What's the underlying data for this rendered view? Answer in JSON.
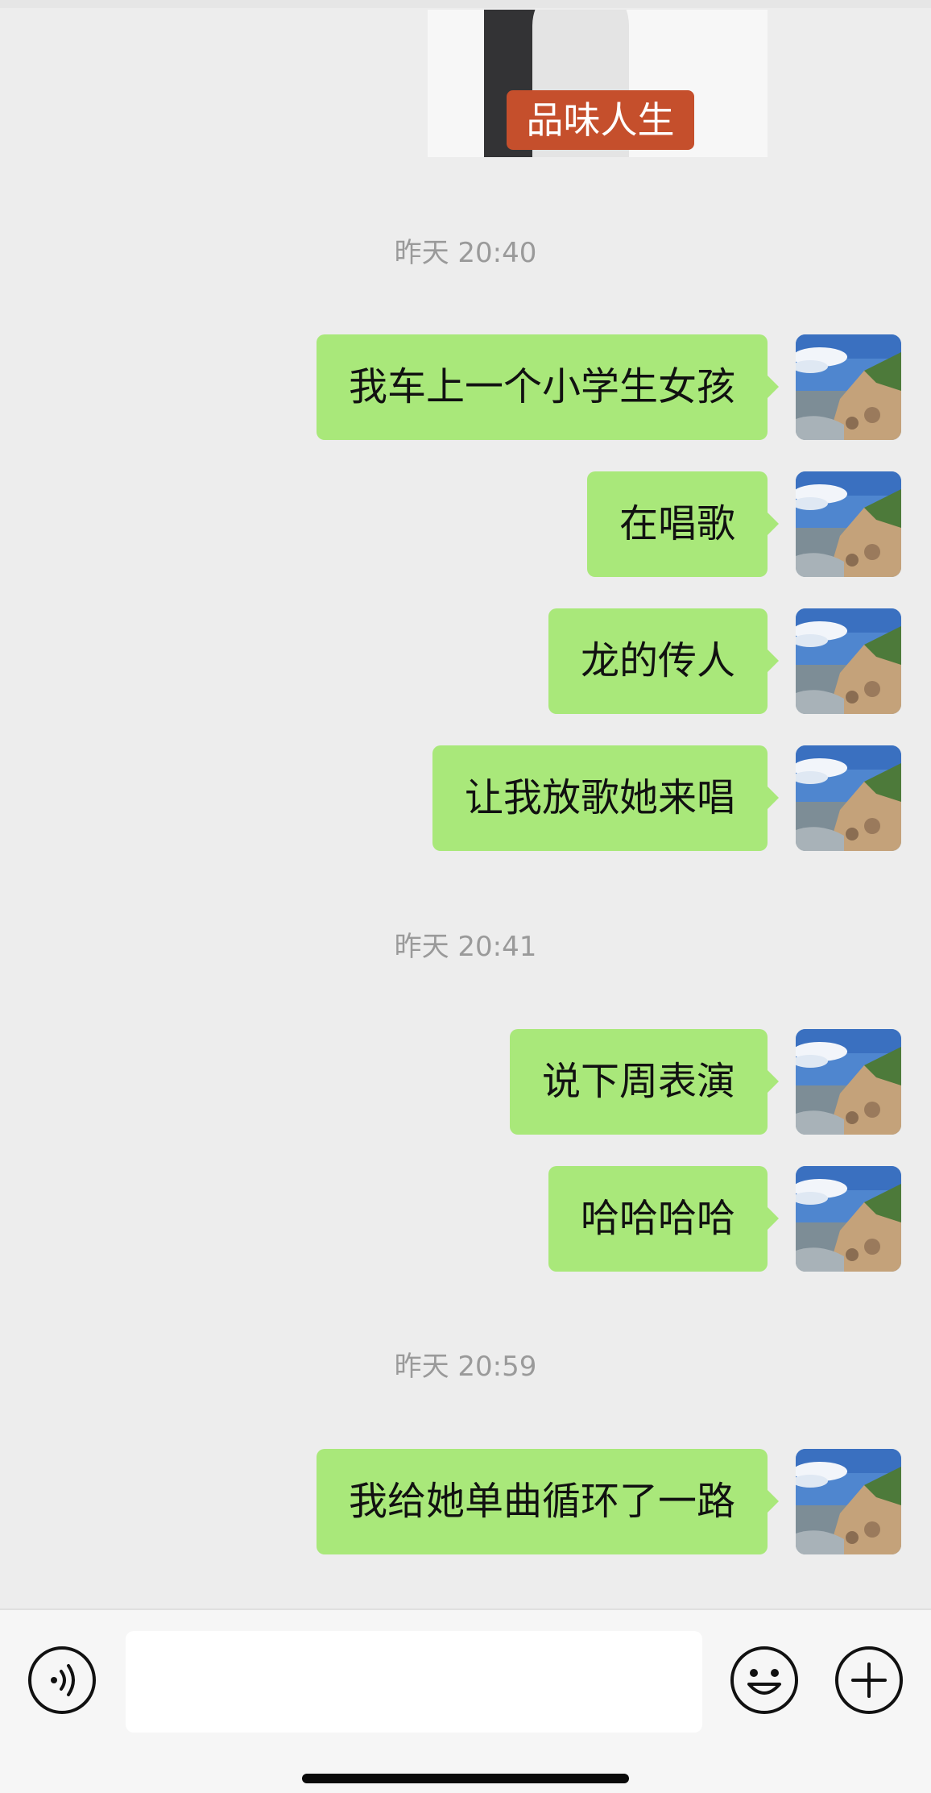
{
  "chat": {
    "image_message": {
      "caption": "品味人生"
    },
    "groups": [
      {
        "timestamp": "昨天 20:40",
        "messages": [
          "我车上一个小学生女孩",
          "在唱歌",
          "龙的传人",
          "让我放歌她来唱"
        ]
      },
      {
        "timestamp": "昨天 20:41",
        "messages": [
          "说下周表演",
          "哈哈哈哈"
        ]
      },
      {
        "timestamp": "昨天 20:59",
        "messages": [
          "我给她单曲循环了一路"
        ]
      }
    ],
    "avatar_icon": "landscape-avatar-icon"
  },
  "input_bar": {
    "voice_icon": "voice-icon",
    "text_value": "",
    "emoji_icon": "emoji-icon",
    "plus_icon": "plus-icon"
  },
  "colors": {
    "background": "#ededed",
    "sent_bubble": "#a9e87a",
    "timestamp": "#9a9a9a",
    "caption_bg": "#c54f2c"
  }
}
